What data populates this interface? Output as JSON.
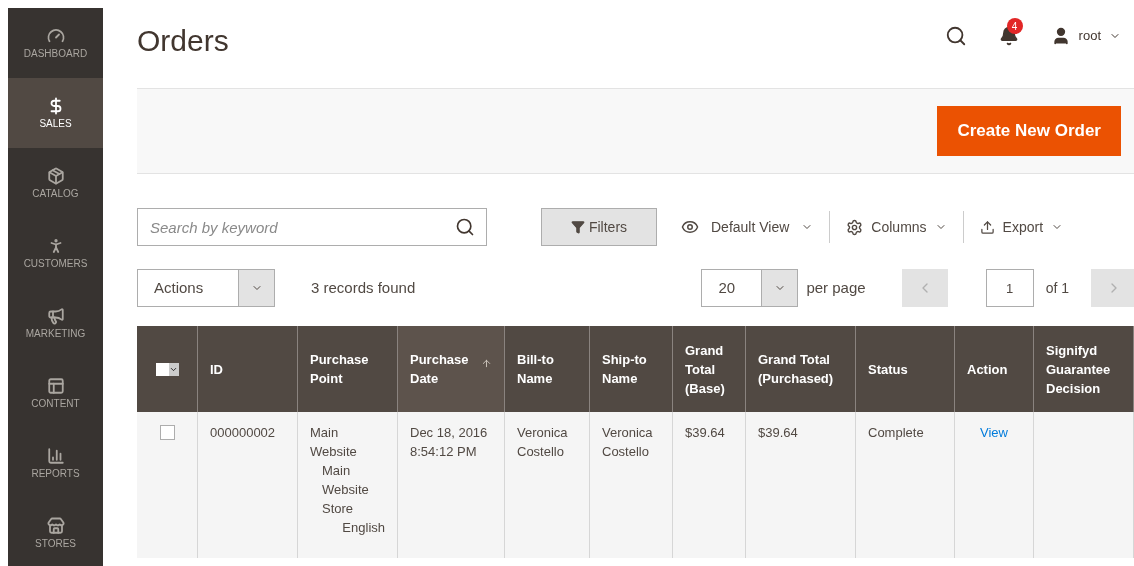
{
  "sidebar": {
    "items": [
      {
        "label": "DASHBOARD",
        "selected": false
      },
      {
        "label": "SALES",
        "selected": true
      },
      {
        "label": "CATALOG",
        "selected": false
      },
      {
        "label": "CUSTOMERS",
        "selected": false
      },
      {
        "label": "MARKETING",
        "selected": false
      },
      {
        "label": "CONTENT",
        "selected": false
      },
      {
        "label": "REPORTS",
        "selected": false
      },
      {
        "label": "STORES",
        "selected": false
      }
    ]
  },
  "header": {
    "title": "Orders",
    "notifications": "4",
    "user": "root"
  },
  "actions_bar": {
    "button": "Create New Order"
  },
  "toolbar": {
    "search": {
      "placeholder": "Search by keyword"
    },
    "filters": "Filters",
    "view": "Default View",
    "columns": "Columns",
    "export": "Export"
  },
  "grid_controls": {
    "mass_action": "Actions",
    "records": "3 records found",
    "page_size": "20",
    "per_page": "per page",
    "page": "1",
    "of": "of 1"
  },
  "table": {
    "select_all": {
      "checked": false
    },
    "columns": [
      {
        "label": "ID",
        "sorted": false
      },
      {
        "label": "Purchase Point",
        "sorted": false
      },
      {
        "label": "Purchase Date",
        "sorted": true
      },
      {
        "label": "Bill-to Name",
        "sorted": false
      },
      {
        "label": "Ship-to Name",
        "sorted": false
      },
      {
        "label": "Grand Total (Base)",
        "sorted": false
      },
      {
        "label": "Grand Total (Purchased)",
        "sorted": false
      },
      {
        "label": "Status",
        "sorted": false
      },
      {
        "label": "Action",
        "sorted": false
      },
      {
        "label": "Signifyd Guarantee Decision",
        "sorted": false
      }
    ],
    "rows": [
      {
        "checked": false,
        "id": "000000002",
        "purchase_point": [
          "Main Website",
          "Main Website Store",
          "English"
        ],
        "date": "Dec 18, 2016 8:54:12 PM",
        "bill_to": "Veronica Costello",
        "ship_to": "Veronica Costello",
        "total_base": "$39.64",
        "total_purchased": "$39.64",
        "status": "Complete",
        "action": "View"
      }
    ]
  }
}
